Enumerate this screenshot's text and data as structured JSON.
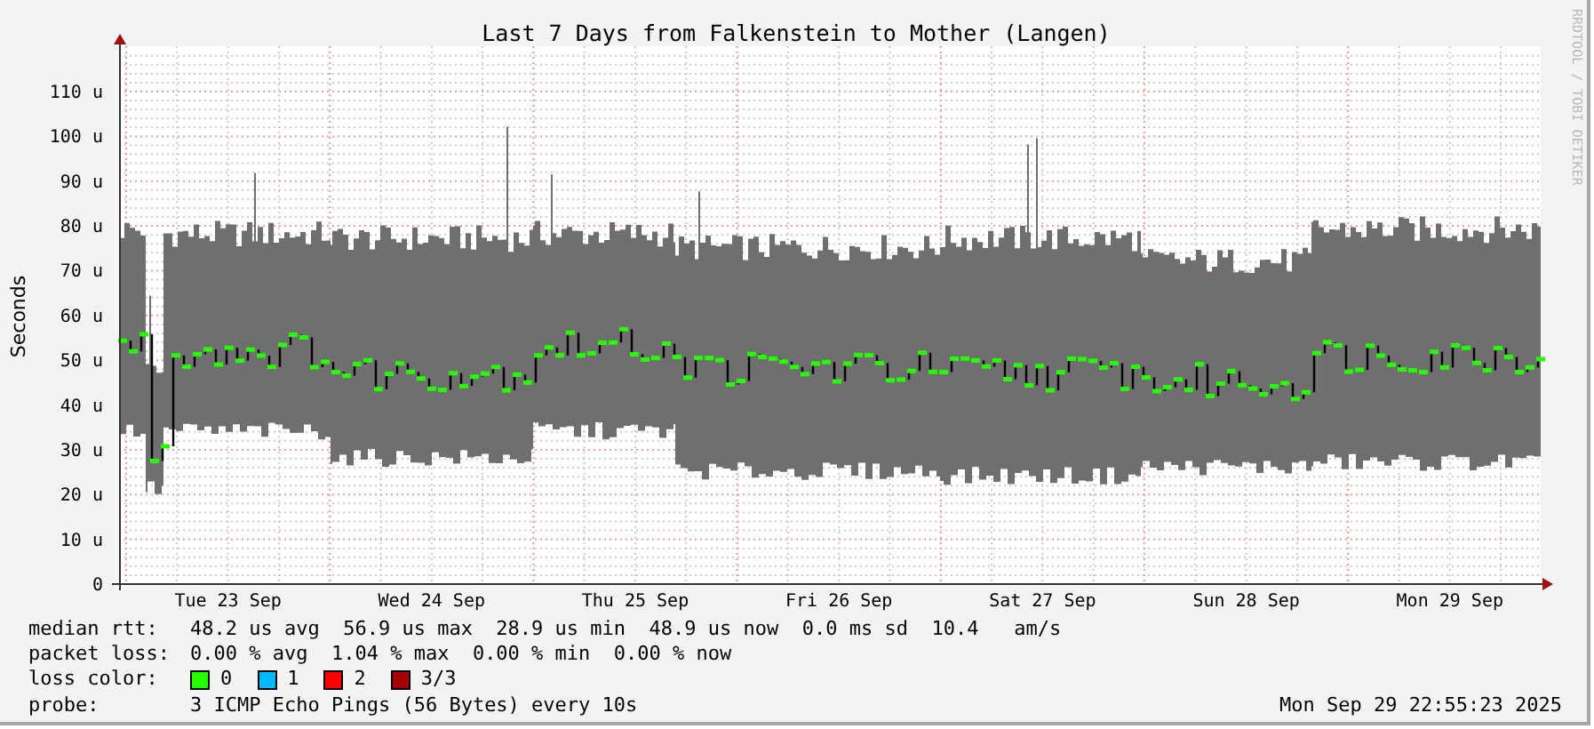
{
  "title": "Last 7 Days from Falkenstein to Mother (Langen)",
  "credit": "RRDTOOL / TOBI OETIKER",
  "y_axis": {
    "label": "Seconds",
    "ticks": [
      "110 u",
      "100 u",
      "90 u",
      "80 u",
      "70 u",
      "60 u",
      "50 u",
      "40 u",
      "30 u",
      "20 u",
      "10 u",
      "0"
    ]
  },
  "x_axis": {
    "ticks": [
      "Tue 23 Sep",
      "Wed 24 Sep",
      "Thu 25 Sep",
      "Fri 26 Sep",
      "Sat 27 Sep",
      "Sun 28 Sep",
      "Mon 29 Sep"
    ]
  },
  "legend": {
    "rows": [
      {
        "label": "median rtt:",
        "value": "48.2 us avg  56.9 us max  28.9 us min  48.9 us now  0.0 ms sd  10.4   am/s"
      },
      {
        "label": "packet loss:",
        "value": "0.00 % avg  1.04 % max  0.00 % min  0.00 % now"
      }
    ],
    "loss_color": {
      "label": "loss color:",
      "items": [
        {
          "text": "0",
          "color": "#26ff00"
        },
        {
          "text": "1",
          "color": "#00b8ff"
        },
        {
          "text": "2",
          "color": "#ff0000"
        },
        {
          "text": "3/3",
          "color": "#a80000"
        }
      ]
    },
    "probe": {
      "label": "probe:",
      "value": "3 ICMP Echo Pings (56 Bytes) every 10s"
    },
    "timestamp": "Mon Sep 29 22:55:23 2025"
  }
}
